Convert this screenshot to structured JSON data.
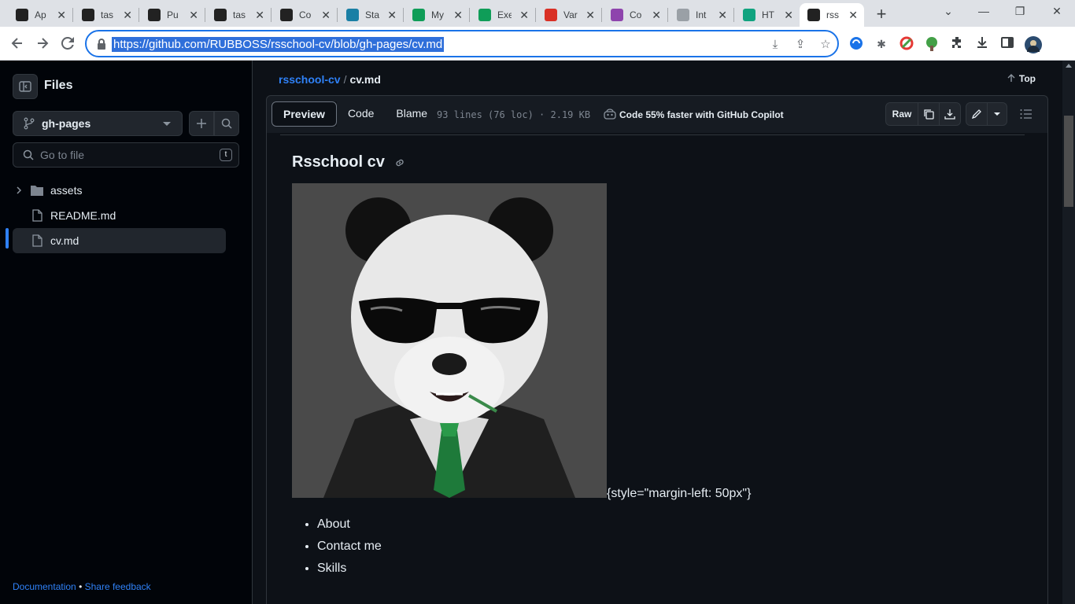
{
  "browser": {
    "tabs": [
      {
        "title": "Ap",
        "favicon": "rs-logo",
        "color": "#222"
      },
      {
        "title": "tas",
        "favicon": "github-icon",
        "color": "#222"
      },
      {
        "title": "Pu",
        "favicon": "rs-logo",
        "color": "#222"
      },
      {
        "title": "tas",
        "favicon": "github-icon",
        "color": "#222"
      },
      {
        "title": "Co",
        "favicon": "github-icon",
        "color": "#222"
      },
      {
        "title": "Sta",
        "favicon": "book-icon",
        "color": "#1a7fa5"
      },
      {
        "title": "My",
        "favicon": "w-icon",
        "color": "#0f9d58"
      },
      {
        "title": "Exe",
        "favicon": "w-icon",
        "color": "#0f9d58"
      },
      {
        "title": "Var",
        "favicon": "figure-icon",
        "color": "#d93025"
      },
      {
        "title": "Co",
        "favicon": "u-icon",
        "color": "#8e44ad"
      },
      {
        "title": "Int",
        "favicon": "globe-icon",
        "color": "#9aa0a6"
      },
      {
        "title": "HT",
        "favicon": "openai-icon",
        "color": "#10a37f"
      },
      {
        "title": "rss",
        "favicon": "github-icon",
        "color": "#222"
      }
    ],
    "url": "https://github.com/RUBBOSS/rsschool-cv/blob/gh-pages/cv.md"
  },
  "sidebar": {
    "title": "Files",
    "branch": "gh-pages",
    "search_placeholder": "Go to file",
    "search_shortcut": "t",
    "items": [
      {
        "label": "assets",
        "type": "folder"
      },
      {
        "label": "README.md",
        "type": "file"
      },
      {
        "label": "cv.md",
        "type": "file",
        "selected": true
      }
    ],
    "footer": {
      "docs": "Documentation",
      "bullet": "•",
      "feedback": "Share feedback"
    }
  },
  "header": {
    "repo": "rsschool-cv",
    "separator": "/",
    "file": "cv.md",
    "top_label": "Top"
  },
  "filebar": {
    "tabs": [
      "Preview",
      "Code",
      "Blame"
    ],
    "active_tab": "Preview",
    "meta": "93 lines (76 loc) · 2.19 KB",
    "copilot": "Code 55% faster with GitHub Copilot",
    "raw_label": "Raw"
  },
  "markdown": {
    "title": "Rsschool cv",
    "style_text": "{style=\"margin-left: 50px\"}",
    "list": [
      "About",
      "Contact me",
      "Skills"
    ]
  },
  "colors": {
    "accent": "#2f81f7",
    "background": "#0d1117",
    "sidebar_bg": "#010409",
    "border": "#30363d"
  }
}
